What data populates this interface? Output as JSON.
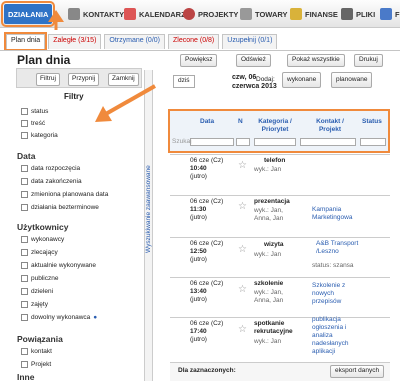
{
  "nav": [
    {
      "label": "DZIAŁANIA",
      "color": "#2f73c6"
    },
    {
      "label": "KONTAKTY",
      "color": "#888"
    },
    {
      "label": "KALENDARZ",
      "color": "#d55"
    },
    {
      "label": "PROJEKTY",
      "color": "#b44"
    },
    {
      "label": "TOWARY",
      "color": "#999"
    },
    {
      "label": "FINANSE",
      "color": "#d9b23a"
    },
    {
      "label": "PLIKI",
      "color": "#666"
    },
    {
      "label": "FL",
      "color": "#4a7ac9"
    }
  ],
  "tabs": [
    {
      "label": "Plan dnia",
      "count": ""
    },
    {
      "label": "Zaległe ",
      "count": "(3/15)"
    },
    {
      "label": "Otrzymane ",
      "count": "(0/0)"
    },
    {
      "label": "Zlecone ",
      "count": "(0/8)"
    },
    {
      "label": "Uzupełnij ",
      "count": "(0/1)"
    }
  ],
  "page_title": "Plan dnia",
  "toolbar": {
    "enlarge": "Powiększ",
    "refresh": "Odśwież",
    "show_all": "Pokaż wszystkie",
    "print": "Drukuj"
  },
  "filter_buttons": {
    "filter": "Filtruj",
    "stick": "Przypnij",
    "close": "Zamknij"
  },
  "filters": {
    "title": "Filtry",
    "g1": [
      "status",
      "treść",
      "kategoria"
    ],
    "data_title": "Data",
    "data": [
      "data rozpoczęcia",
      "data zakończenia",
      "zmieniona planowana data",
      "działania bezterminowe"
    ],
    "users_title": "Użytkownicy",
    "users": [
      "wykonawcy",
      "zlecający",
      "aktualnie wykonywane",
      "publiczne",
      "dzieleni",
      "zajęty",
      "dowolny wykonawca"
    ],
    "rel_title": "Powiązania",
    "rel": [
      "kontakt",
      "Projekt"
    ],
    "other_title": "Inne"
  },
  "sidebar_vertical": "Wyszukiwanie zaawansowane",
  "view": {
    "today": "dziś",
    "date_line1": "czw, 06",
    "date_line2": "czerwca 2013",
    "add_label": "Dodaj:",
    "done": "wykonane",
    "planned": "planowane"
  },
  "table": {
    "headers": {
      "data": "Data",
      "n": "N",
      "cat": "Kategoria / Priorytet",
      "contact": "Kontakt / Projekt",
      "status": "Status"
    },
    "search_placeholder": "Szukaj",
    "rows": [
      {
        "date": "06 cze (Cz)",
        "time": "10:40",
        "rel": "(jutro)",
        "cat": "telefon",
        "wyk": "wyk.: Jan",
        "contact": "",
        "status": ""
      },
      {
        "date": "06 cze (Cz)",
        "time": "11:30",
        "rel": "(jutro)",
        "cat": "prezentacja",
        "wyk": "wyk.: Jan, Anna, Jan",
        "contact": "Kampania Marketingowa",
        "status": ""
      },
      {
        "date": "06 cze (Cz)",
        "time": "12:50",
        "rel": "(jutro)",
        "cat": "wizyta",
        "wyk": "wyk.: Jan",
        "contact": "A&B Transport /Leszno",
        "status": "status: szansa"
      },
      {
        "date": "06 cze (Cz)",
        "time": "13:40",
        "rel": "(jutro)",
        "cat": "szkolenie",
        "wyk": "wyk.: Jan, Anna, Jan",
        "contact": "Szkolenie z nowych przepisów",
        "status": ""
      },
      {
        "date": "06 cze (Cz)",
        "time": "17:40",
        "rel": "(jutro)",
        "cat": "spotkanie rekrutacyjne",
        "wyk": "wyk.: Jan",
        "contact": "publikacja ogłoszenia i analiza nadesłanych aplikacji",
        "status": ""
      }
    ]
  },
  "footer": {
    "selected": "Dla zaznaczonych:",
    "export": "eksport danych"
  },
  "colors": {
    "accent": "#f08a3c",
    "link": "#2a5db0"
  }
}
